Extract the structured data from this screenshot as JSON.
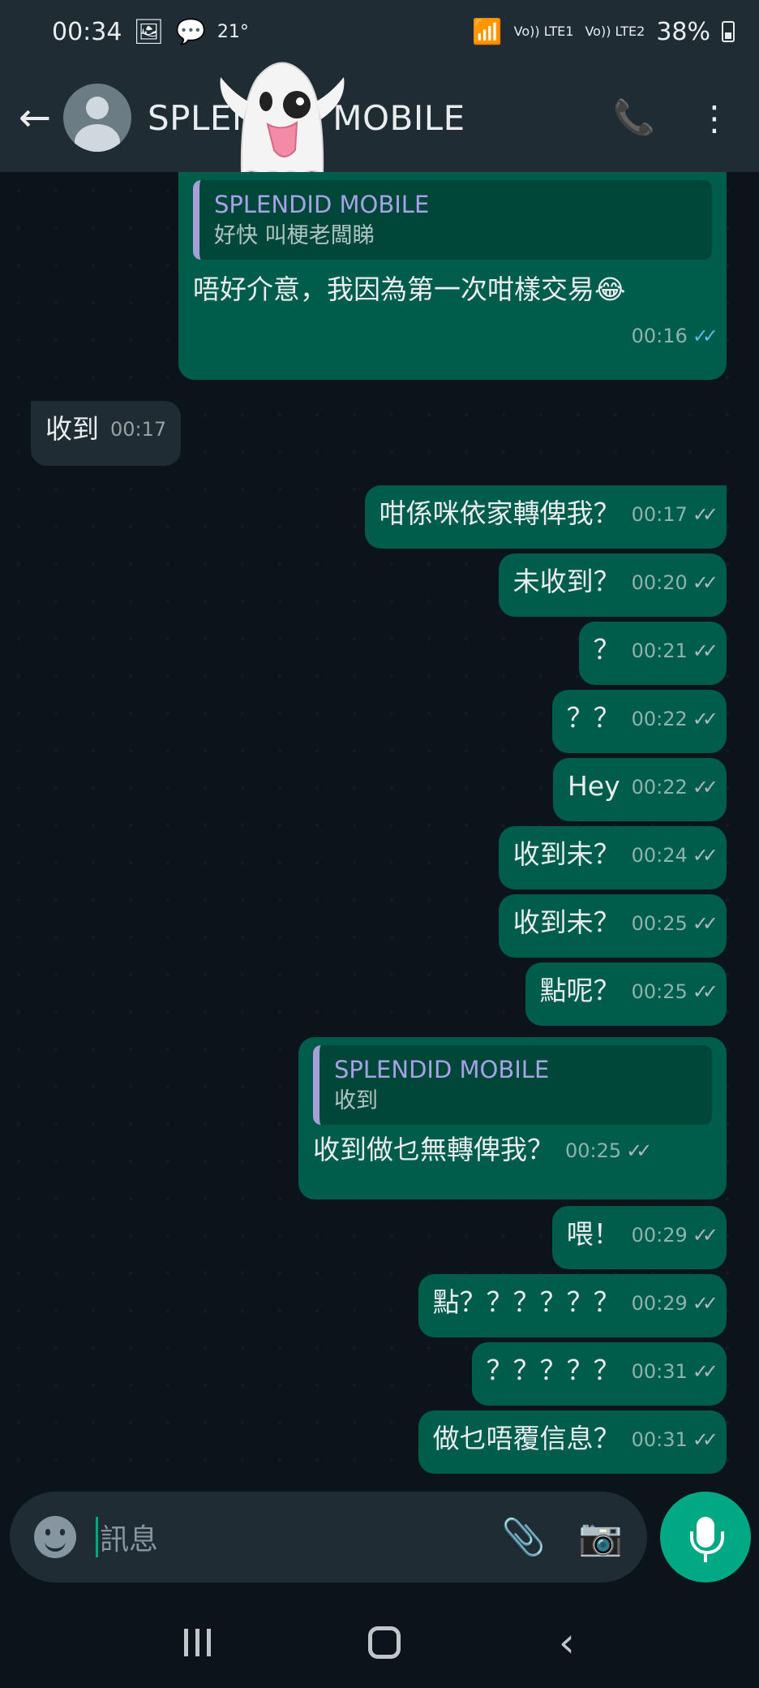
{
  "status_bar": {
    "time": "00:34",
    "temperature": "21°",
    "sim1": "Vo)) LTE1",
    "sim2": "Vo)) LTE2",
    "battery": "38%"
  },
  "header": {
    "contact_name": "SPLENDID MOBILE",
    "back_icon": "arrow-left-icon",
    "call_icon": "add-call-icon",
    "menu_icon": "more-vert-icon"
  },
  "messages": [
    {
      "dir": "out",
      "quote": {
        "author": "SPLENDID MOBILE",
        "text": "好快 叫梗老闆睇"
      },
      "text": "唔好介意，我因為第一次咁樣交易😂",
      "time": "00:16",
      "status": "read"
    },
    {
      "dir": "in",
      "text": "收到",
      "time": "00:17"
    },
    {
      "dir": "out",
      "text": "咁係咪依家轉俾我？",
      "time": "00:17",
      "status": "delivered"
    },
    {
      "dir": "out",
      "text": "未收到？",
      "time": "00:20",
      "status": "delivered"
    },
    {
      "dir": "out",
      "text": "？",
      "time": "00:21",
      "status": "delivered"
    },
    {
      "dir": "out",
      "text": "？？",
      "time": "00:22",
      "status": "delivered"
    },
    {
      "dir": "out",
      "text": "Hey",
      "time": "00:22",
      "status": "delivered"
    },
    {
      "dir": "out",
      "text": "收到未？",
      "time": "00:24",
      "status": "delivered"
    },
    {
      "dir": "out",
      "text": "收到未？",
      "time": "00:25",
      "status": "delivered"
    },
    {
      "dir": "out",
      "text": "點呢？",
      "time": "00:25",
      "status": "delivered"
    },
    {
      "dir": "out",
      "quote": {
        "author": "SPLENDID MOBILE",
        "text": "收到"
      },
      "text": "收到做乜無轉俾我？",
      "time": "00:25",
      "status": "delivered"
    },
    {
      "dir": "out",
      "text": "喂！",
      "time": "00:29",
      "status": "delivered"
    },
    {
      "dir": "out",
      "text": "點？？？？？？",
      "time": "00:29",
      "status": "delivered"
    },
    {
      "dir": "out",
      "text": "？？？？？",
      "time": "00:31",
      "status": "delivered"
    },
    {
      "dir": "out",
      "text": "做乜唔覆信息？",
      "time": "00:31",
      "status": "delivered"
    }
  ],
  "composer": {
    "placeholder": "訊息",
    "emoji_icon": "emoji-icon",
    "attach_icon": "paperclip-icon",
    "camera_icon": "camera-icon",
    "mic_icon": "microphone-icon"
  },
  "colors": {
    "outgoing_bubble": "#005c4b",
    "incoming_bubble": "#202c33",
    "accent": "#00a884",
    "read_ticks": "#53bdeb",
    "quote_author": "#a7a2e6"
  }
}
